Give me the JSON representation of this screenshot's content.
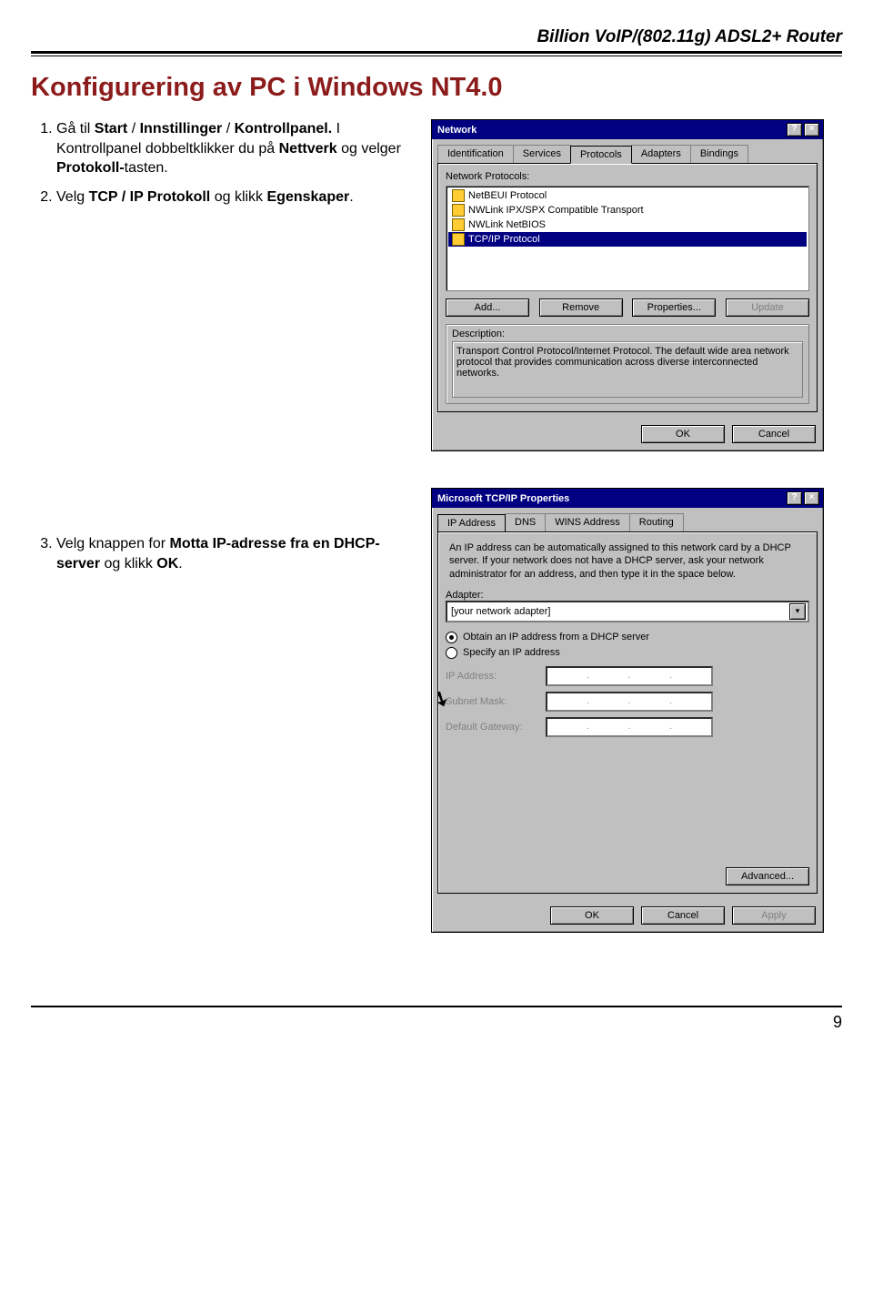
{
  "header": {
    "right": "Billion VoIP/(802.11g) ADSL2+ Router"
  },
  "title": "Konfigurering av PC i Windows NT4.0",
  "steps": {
    "s1a": "Gå til ",
    "s1b": "Start",
    "s1c": " / ",
    "s1d": "Innstillinger",
    "s1e": " / ",
    "s1f": "Kontrollpanel.",
    "s1g": "  I Kontrollpanel dobbeltklikker du på ",
    "s1h": "Nettverk",
    "s1i": " og velger ",
    "s1j": "Protokoll-",
    "s1k": "tasten.",
    "s2a": "Velg ",
    "s2b": "TCP / IP Protokoll",
    "s2c": " og klikk ",
    "s2d": "Egenskaper",
    "s2e": ".",
    "s3a": "Velg knappen for ",
    "s3b": "Motta IP-adresse fra en DHCP-server",
    "s3c": " og klikk ",
    "s3d": "OK",
    "s3e": "."
  },
  "dlg1": {
    "title": "Network",
    "tabs": [
      "Identification",
      "Services",
      "Protocols",
      "Adapters",
      "Bindings"
    ],
    "activeTab": 2,
    "listLabel": "Network Protocols:",
    "items": [
      "NetBEUI Protocol",
      "NWLink IPX/SPX Compatible Transport",
      "NWLink NetBIOS",
      "TCP/IP Protocol"
    ],
    "selectedIndex": 3,
    "btns": {
      "add": "Add...",
      "remove": "Remove",
      "props": "Properties...",
      "update": "Update"
    },
    "descLabel": "Description:",
    "desc": "Transport Control Protocol/Internet Protocol. The default wide area network protocol that provides communication across diverse interconnected networks.",
    "ok": "OK",
    "cancel": "Cancel"
  },
  "dlg2": {
    "title": "Microsoft TCP/IP Properties",
    "tabs": [
      "IP Address",
      "DNS",
      "WINS Address",
      "Routing"
    ],
    "activeTab": 0,
    "para": "An IP address can be automatically assigned to this network card by a DHCP server. If your network does not have a DHCP server, ask your network administrator for an address, and then type it in the space below.",
    "adapterLabel": "Adapter:",
    "adapterValue": "[your network adapter]",
    "opt1": "Obtain an IP address from a DHCP server",
    "opt2": "Specify an IP address",
    "ip": "IP Address:",
    "mask": "Subnet Mask:",
    "gw": "Default Gateway:",
    "adv": "Advanced...",
    "ok": "OK",
    "cancel": "Cancel",
    "apply": "Apply"
  },
  "pageNumber": "9"
}
